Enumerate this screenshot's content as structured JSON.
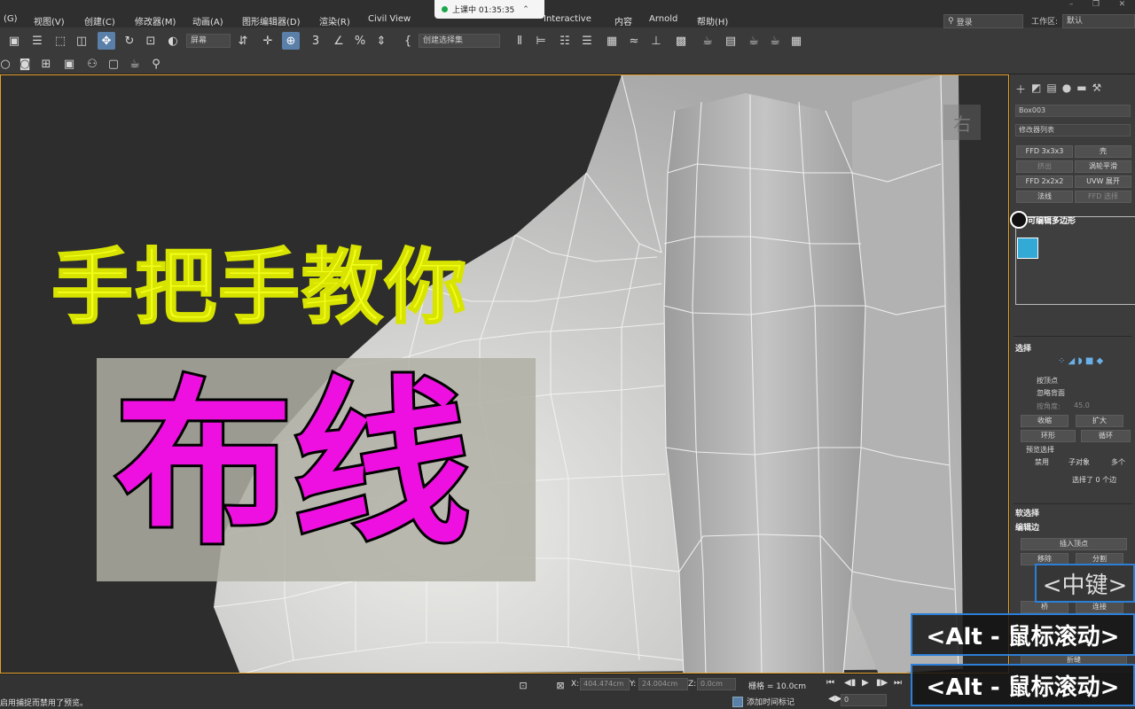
{
  "menu": {
    "items": [
      "(G)",
      "视图(V)",
      "创建(C)",
      "修改器(M)",
      "动画(A)",
      "图形编辑器(D)",
      "渲染(R)",
      "Civil View",
      "Interactive",
      "内容",
      "Arnold",
      "帮助(H)"
    ],
    "recording_label": "上课中 01:35:35",
    "login_label": "登录",
    "workspace_label": "工作区:",
    "workspace_value": "默认"
  },
  "toolbar": {
    "filter_dropdown": "屏幕",
    "selection_set_dropdown": "创建选择集"
  },
  "viewport": {
    "viewcube_label": "右"
  },
  "overlay": {
    "title_line1": "手把手教你",
    "title_line2": "布线"
  },
  "command_panel": {
    "object_name": "Box003",
    "modifier_list": "修改器列表",
    "modifier_buttons": [
      "FFD 3x3x3",
      "壳",
      "挤出",
      "涡轮平滑",
      "FFD 2x2x2",
      "UVW 展开",
      "法线",
      "FFD 选择"
    ],
    "stack_item": "可编辑多边形",
    "selection_section": "选择",
    "by_vertex": "按顶点",
    "ignore_backfacing": "忽略背面",
    "by_angle": "按角度:",
    "by_angle_value": "45.0",
    "shrink": "收缩",
    "grow": "扩大",
    "ring": "环形",
    "loop": "循环",
    "preview_selection": "预览选择",
    "preview_disabled": "禁用",
    "preview_subobject": "子对象",
    "preview_multi": "多个",
    "selected_count": "选择了 0 个边",
    "soft_selection": "软选择",
    "edit_edges": "编辑边",
    "insert_vertex": "插入顶点",
    "remove": "移除",
    "split": "分割",
    "bridge": "桥",
    "connect": "连接",
    "crease": "折缝"
  },
  "key_hints": {
    "middle": "<中键>",
    "alt_scroll_1": "<Alt - 鼠标滚动>",
    "alt_scroll_2": "<Alt - 鼠标滚动>"
  },
  "status": {
    "message": "启用捕捉而禁用了预览。",
    "x_label": "X:",
    "x_value": "404.474cm",
    "y_label": "Y:",
    "y_value": "24.004cm",
    "z_label": "Z:",
    "z_value": "0.0cm",
    "grid": "栅格 = 10.0cm",
    "add_time_tag": "添加时间标记",
    "frame_value": "0"
  },
  "colors": {
    "title_yellow": "#f2ff1a",
    "title_magenta": "#ee10e0",
    "hint_border": "#2c7fd6",
    "viewport_border": "#e3a02b",
    "stack_icon": "#33a9d6"
  }
}
